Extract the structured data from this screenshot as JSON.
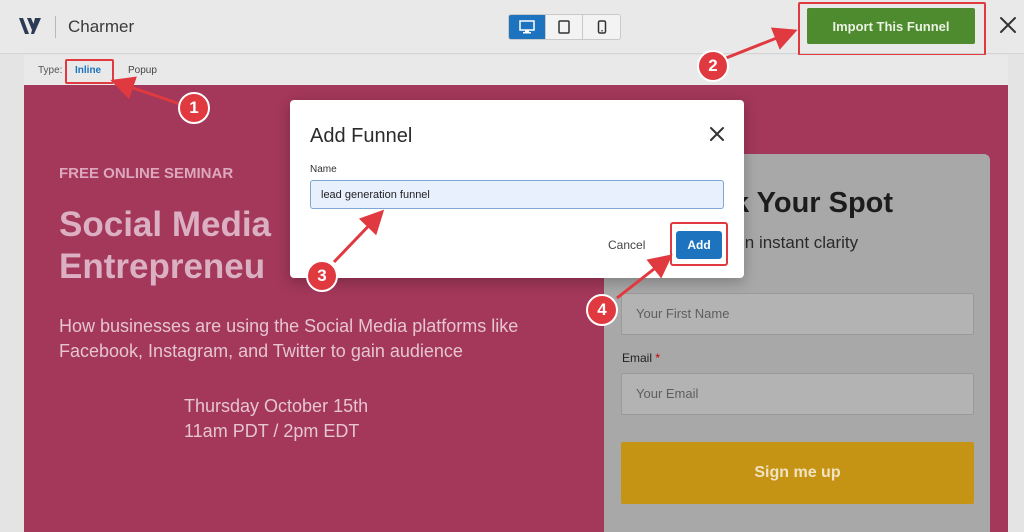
{
  "app": {
    "brand": "Charmer"
  },
  "devices": {
    "desktop_icon": "desktop-icon",
    "tablet_icon": "tablet-icon",
    "mobile_icon": "mobile-icon",
    "active": "desktop"
  },
  "toolbar": {
    "import_label": "Import This Funnel",
    "close_icon": "close-icon"
  },
  "type_bar": {
    "label": "Type:",
    "inline": "Inline",
    "popup": "Popup",
    "selected": "Inline"
  },
  "preview": {
    "eyebrow": "FREE ONLINE SEMINAR",
    "headline_line1": "Social Media",
    "headline_line2": "Entrepreneu",
    "description": "How businesses are using the Social Media platforms like Facebook, Instagram, and Twitter to gain audience",
    "date_line1": "Thursday October 15th",
    "date_line2": "11am PDT / 2pm EDT",
    "card": {
      "title": "k Your Spot",
      "subtitle": "in instant clarity",
      "first_name_placeholder": "Your First Name",
      "email_label": "Email",
      "email_required": "*",
      "email_placeholder": "Your Email",
      "submit_label": "Sign me up"
    }
  },
  "modal": {
    "title": "Add Funnel",
    "name_label": "Name",
    "name_value": "lead generation funnel",
    "cancel_label": "Cancel",
    "add_label": "Add"
  },
  "annotations": {
    "steps": [
      "1",
      "2",
      "3",
      "4"
    ]
  },
  "colors": {
    "accent": "#1e73be",
    "import_green": "#4e8a2e",
    "annotation_red": "#e0393f",
    "preview_bg": "#a3385a",
    "signup_gold": "#c69414"
  }
}
